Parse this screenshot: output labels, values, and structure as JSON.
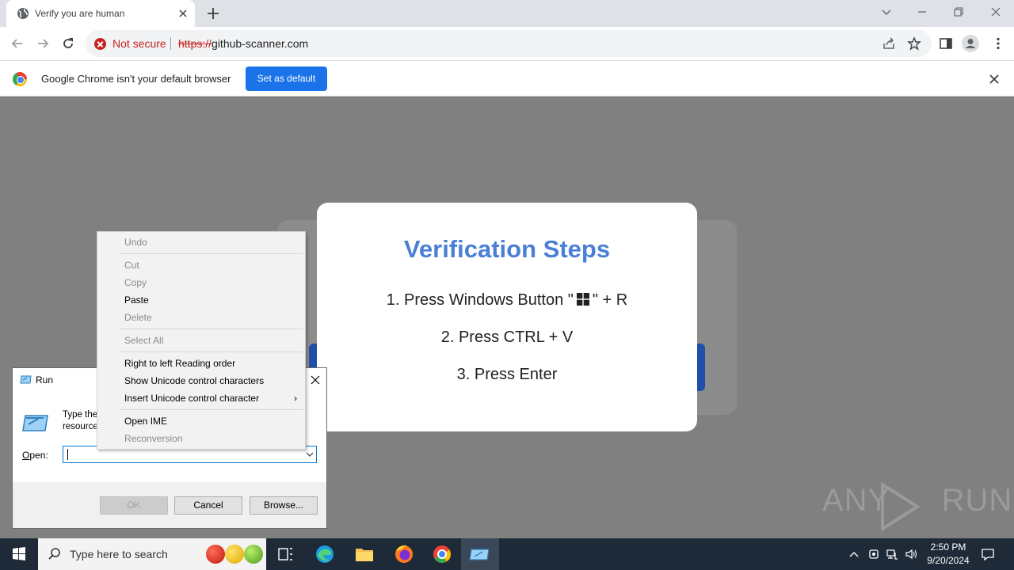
{
  "browser": {
    "tab_title": "Verify you are human",
    "security_label": "Not secure",
    "url_scheme": "https://",
    "url_host": "github-scanner.com",
    "infobar_text": "Google Chrome isn't your default browser",
    "infobar_button": "Set as default"
  },
  "page": {
    "title": "Verification Steps",
    "step1_prefix": "1. Press Windows Button \"",
    "step1_suffix": "\" + R",
    "step2": "2. Press CTRL + V",
    "step3": "3. Press Enter",
    "watermark": "ANY RUN",
    "accent_color": "#4a7fd6"
  },
  "run_dialog": {
    "title": "Run",
    "description_line1": "Type the",
    "description_line2": "resource",
    "description_tail": "t",
    "open_label_underlined": "O",
    "open_label_rest": "pen:",
    "open_value": "",
    "ok": "OK",
    "cancel": "Cancel",
    "browse": "Browse..."
  },
  "context_menu": {
    "undo": "Undo",
    "cut": "Cut",
    "copy": "Copy",
    "paste": "Paste",
    "delete": "Delete",
    "select_all": "Select All",
    "rtl": "Right to left Reading order",
    "show_unicode": "Show Unicode control characters",
    "insert_unicode": "Insert Unicode control character",
    "open_ime": "Open IME",
    "reconversion": "Reconversion"
  },
  "taskbar": {
    "search_placeholder": "Type here to search",
    "time": "2:50 PM",
    "date": "9/20/2024"
  }
}
